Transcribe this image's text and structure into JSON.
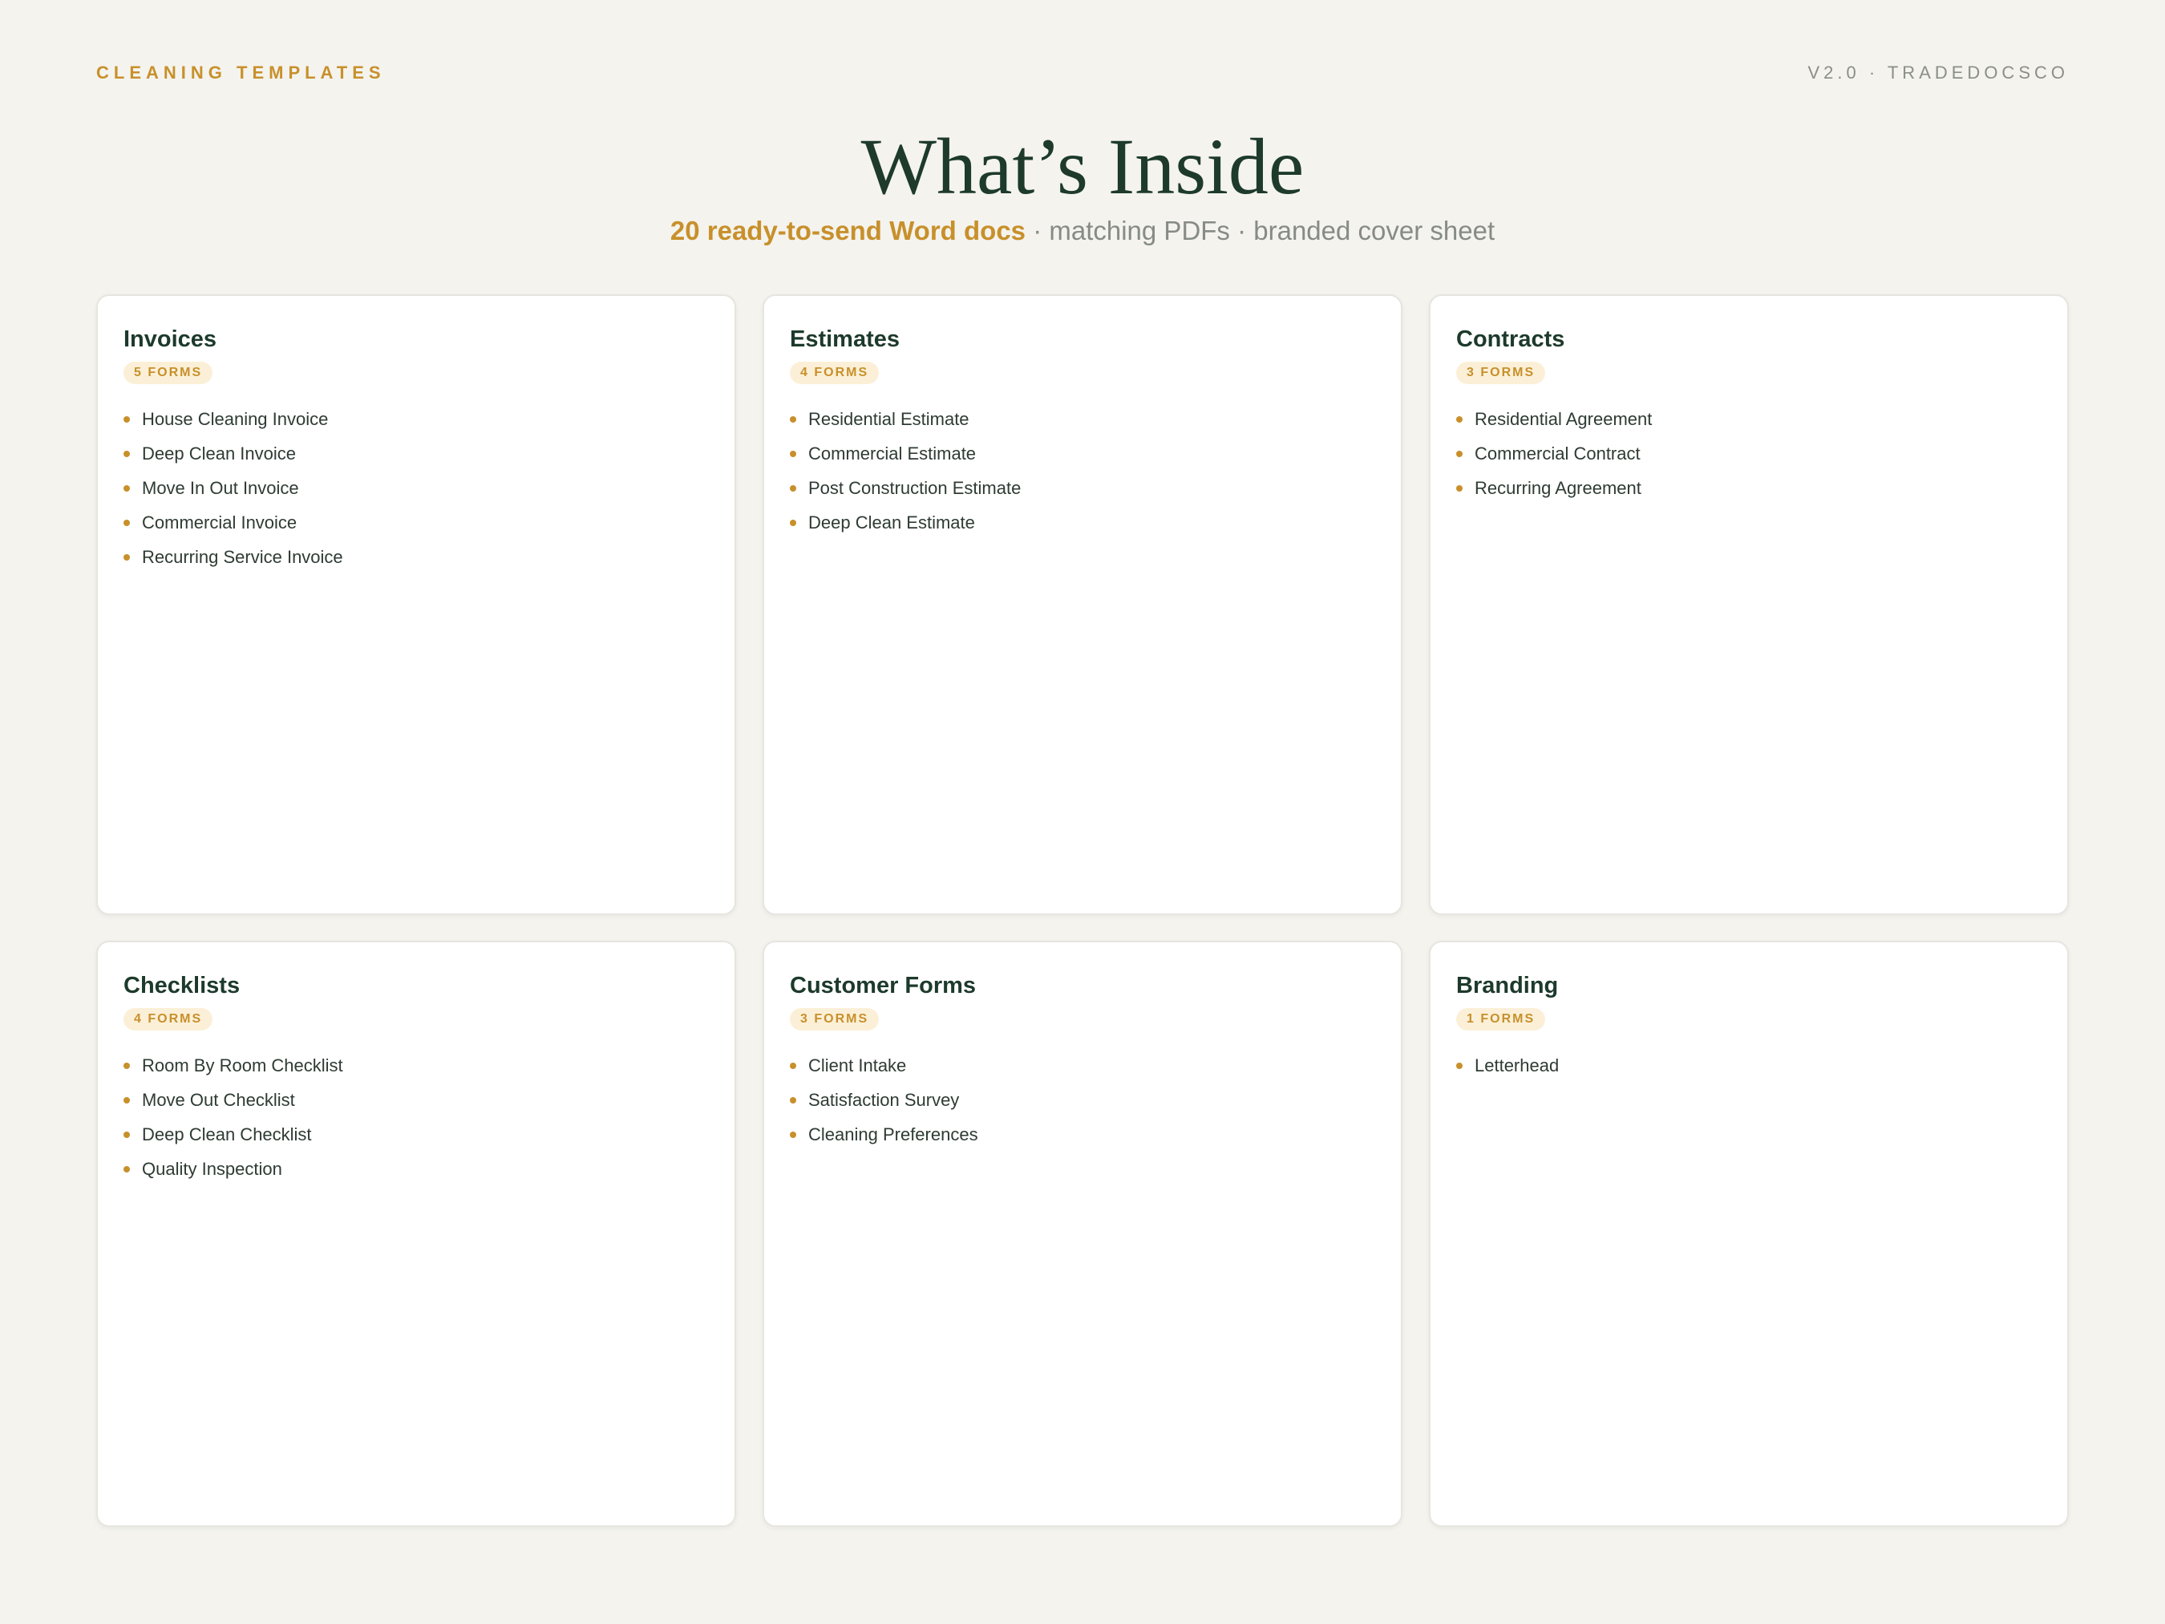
{
  "header": {
    "brand": "CLEANING TEMPLATES",
    "version": "V2.0 · TRADEDOCSCO"
  },
  "hero": {
    "title": "What’s Inside",
    "subtitle_highlight": "20 ready-to-send Word docs",
    "subtitle_rest": " · matching PDFs · branded cover sheet"
  },
  "colors": {
    "accent": "#c8902b",
    "heading": "#1d3a2b",
    "background": "#f4f3ee",
    "card": "#ffffff",
    "badge_bg": "#fbf0d7"
  },
  "categories": [
    {
      "title": "Invoices",
      "badge": "5 FORMS",
      "items": [
        "House Cleaning Invoice",
        "Deep Clean Invoice",
        "Move In Out Invoice",
        "Commercial Invoice",
        "Recurring Service Invoice"
      ]
    },
    {
      "title": "Estimates",
      "badge": "4 FORMS",
      "items": [
        "Residential Estimate",
        "Commercial Estimate",
        "Post Construction Estimate",
        "Deep Clean Estimate"
      ]
    },
    {
      "title": "Contracts",
      "badge": "3 FORMS",
      "items": [
        "Residential Agreement",
        "Commercial Contract",
        "Recurring Agreement"
      ]
    },
    {
      "title": "Checklists",
      "badge": "4 FORMS",
      "items": [
        "Room By Room Checklist",
        "Move Out Checklist",
        "Deep Clean Checklist",
        "Quality Inspection"
      ]
    },
    {
      "title": "Customer Forms",
      "badge": "3 FORMS",
      "items": [
        "Client Intake",
        "Satisfaction Survey",
        "Cleaning Preferences"
      ]
    },
    {
      "title": "Branding",
      "badge": "1 FORMS",
      "items": [
        "Letterhead"
      ]
    }
  ]
}
